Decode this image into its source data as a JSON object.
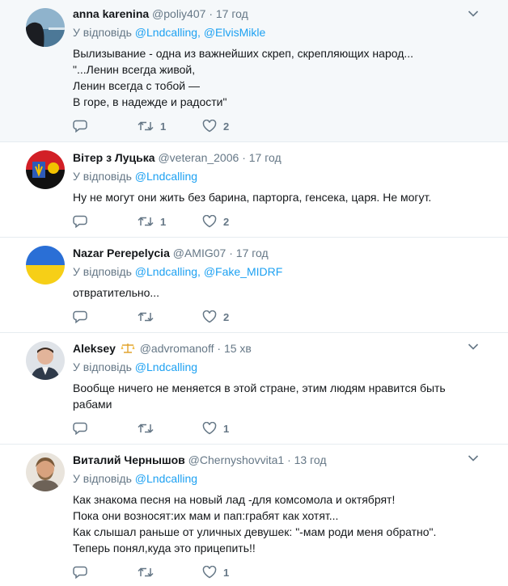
{
  "reply_prefix": "У відповідь",
  "tweets": [
    {
      "name": "anna karenina",
      "handle": "@poliy407",
      "time": "17 год",
      "mentions": [
        "@Lndcalling",
        "@ElvisMikle"
      ],
      "lines": [
        "Вылизывание - одна из важнейших скреп, скрепляющих народ...",
        "\"...Ленин всегда живой,",
        "Ленин всегда с тобой —",
        "В горе, в надежде и радости\""
      ],
      "retweets": "1",
      "likes": "2"
    },
    {
      "name": "Вітер з Луцька",
      "handle": "@veteran_2006",
      "time": "17 год",
      "mentions": [
        "@Lndcalling"
      ],
      "lines": [
        "Ну не могут они жить без барина, парторга, генсека, царя. Не могут."
      ],
      "retweets": "1",
      "likes": "2"
    },
    {
      "name": "Nazar Perepelycia",
      "handle": "@AMIG07",
      "time": "17 год",
      "mentions": [
        "@Lndcalling",
        "@Fake_MIDRF"
      ],
      "lines": [
        "отвратительно..."
      ],
      "retweets": "",
      "likes": "2"
    },
    {
      "name": "Aleksey",
      "handle": "@advromanoff",
      "time": "15 хв",
      "mentions": [
        "@Lndcalling"
      ],
      "lines": [
        "Вообще ничего не меняется в этой стране, этим людям нравится быть",
        "рабами"
      ],
      "retweets": "",
      "likes": "1"
    },
    {
      "name": "Виталий Чернышов",
      "handle": "@Chernyshovvita1",
      "time": "13 год",
      "mentions": [
        "@Lndcalling"
      ],
      "lines": [
        "Как знакома песня на новый лад -для комсомола и октябрят!",
        "Пока они возносят:их мам и пап:грабят как хотят...",
        "Как слышал раньше от уличных девушек: \"-мам роди меня обратно\".",
        "Теперь понял,куда это прицепить!!"
      ],
      "retweets": "",
      "likes": "1"
    }
  ],
  "colors": {
    "link": "#1da1f2",
    "secondary": "#657786",
    "highlight_bg": "#f5f8fa",
    "divider": "#e6ecf0"
  }
}
